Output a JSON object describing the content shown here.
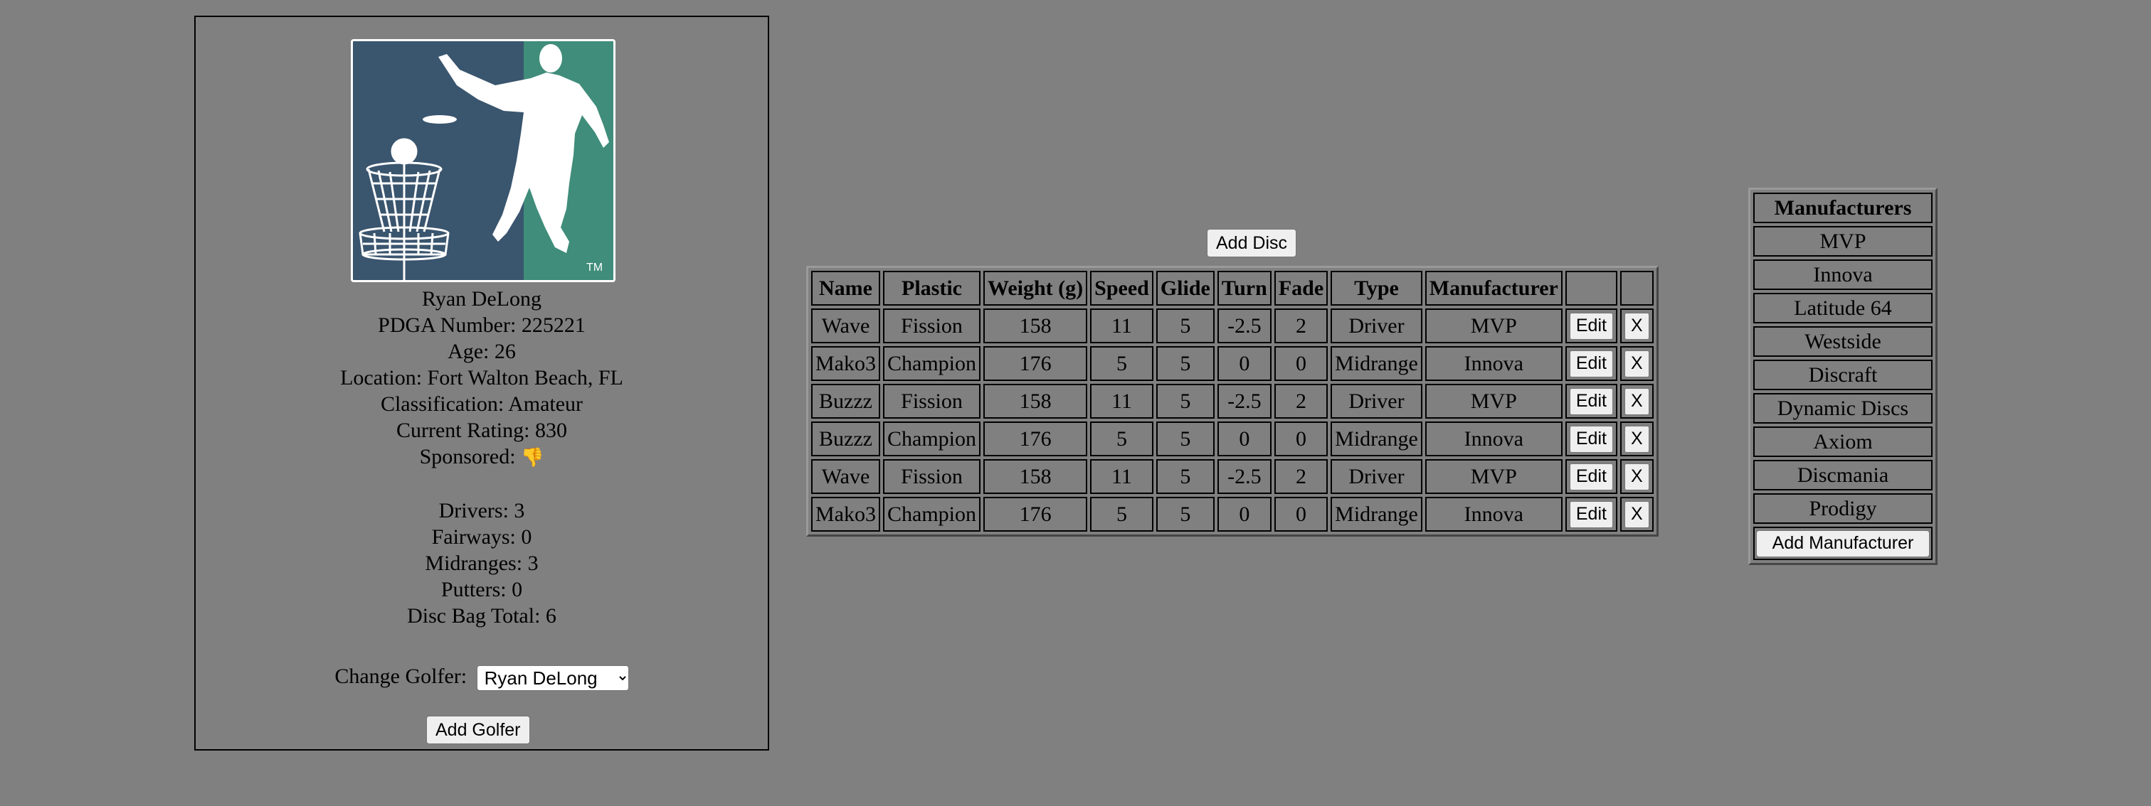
{
  "golfer": {
    "name": "Ryan DeLong",
    "pdga": "PDGA Number: 225221",
    "age": "Age: 26",
    "location": "Location: Fort Walton Beach, FL",
    "classification": "Classification: Amateur",
    "rating": "Current Rating: 830",
    "sponsored_label": "Sponsored:",
    "sponsored_emoji": "👎",
    "drivers": "Drivers: 3",
    "fairways": "Fairways: 0",
    "midranges": "Midranges: 3",
    "putters": "Putters: 0",
    "bag_total": "Disc Bag Total: 6",
    "change_label": "Change Golfer:",
    "selected_golfer": "Ryan DeLong",
    "add_golfer_label": "Add Golfer",
    "logo_tm": "TM"
  },
  "discs": {
    "add_label": "Add Disc",
    "headers": [
      "Name",
      "Plastic",
      "Weight (g)",
      "Speed",
      "Glide",
      "Turn",
      "Fade",
      "Type",
      "Manufacturer",
      "",
      ""
    ],
    "edit_label": "Edit",
    "delete_label": "X",
    "rows": [
      [
        "Wave",
        "Fission",
        "158",
        "11",
        "5",
        "-2.5",
        "2",
        "Driver",
        "MVP"
      ],
      [
        "Mako3",
        "Champion",
        "176",
        "5",
        "5",
        "0",
        "0",
        "Midrange",
        "Innova"
      ],
      [
        "Buzzz",
        "Fission",
        "158",
        "11",
        "5",
        "-2.5",
        "2",
        "Driver",
        "MVP"
      ],
      [
        "Buzzz",
        "Champion",
        "176",
        "5",
        "5",
        "0",
        "0",
        "Midrange",
        "Innova"
      ],
      [
        "Wave",
        "Fission",
        "158",
        "11",
        "5",
        "-2.5",
        "2",
        "Driver",
        "MVP"
      ],
      [
        "Mako3",
        "Champion",
        "176",
        "5",
        "5",
        "0",
        "0",
        "Midrange",
        "Innova"
      ]
    ]
  },
  "manufacturers": {
    "header": "Manufacturers",
    "items": [
      "MVP",
      "Innova",
      "Latitude 64",
      "Westside",
      "Discraft",
      "Dynamic Discs",
      "Axiom",
      "Discmania",
      "Prodigy"
    ],
    "add_label": "Add Manufacturer"
  },
  "colors": {
    "background": "#808080",
    "logo_left": "#3a556e",
    "logo_right": "#3f8d7a"
  }
}
